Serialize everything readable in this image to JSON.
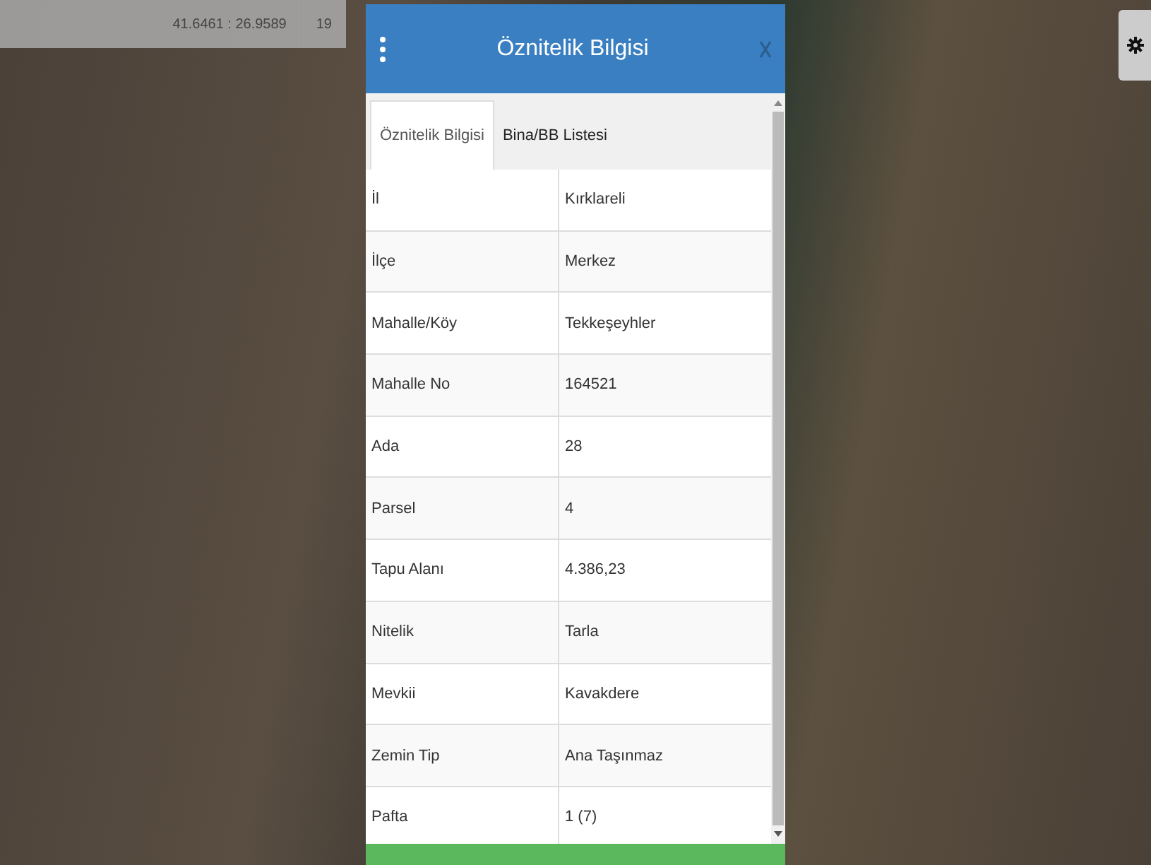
{
  "coordinate_bar": {
    "coordinates": "41.6461 : 26.9589",
    "zoom": "19"
  },
  "panel": {
    "title": "Öznitelik Bilgisi",
    "tabs": [
      {
        "label": "Öznitelik Bilgisi",
        "selected": true
      },
      {
        "label": "Bina/BB Listesi",
        "selected": false
      }
    ],
    "rows": [
      {
        "field": "İl",
        "value": "Kırklareli"
      },
      {
        "field": "İlçe",
        "value": "Merkez"
      },
      {
        "field": "Mahalle/Köy",
        "value": "Tekkeşeyhler"
      },
      {
        "field": "Mahalle No",
        "value": "164521"
      },
      {
        "field": "Ada",
        "value": "28"
      },
      {
        "field": "Parsel",
        "value": "4"
      },
      {
        "field": "Tapu Alanı",
        "value": "4.386,23"
      },
      {
        "field": "Nitelik",
        "value": "Tarla"
      },
      {
        "field": "Mevkii",
        "value": "Kavakdere"
      },
      {
        "field": "Zemin Tip",
        "value": "Ana Taşınmaz"
      },
      {
        "field": "Pafta",
        "value": "1 (7)"
      }
    ]
  }
}
